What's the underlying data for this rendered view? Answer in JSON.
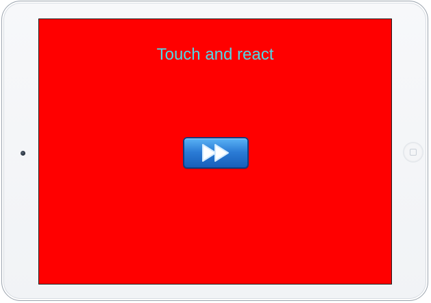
{
  "screen": {
    "title": "Touch and react",
    "background_color": "#ff0000",
    "title_color": "#50d8e6"
  },
  "controls": {
    "play_button_icon": "fast-forward-icon",
    "play_button_color": "#2a7bd5"
  },
  "device": {
    "frame_color": "#f4f5f7"
  }
}
